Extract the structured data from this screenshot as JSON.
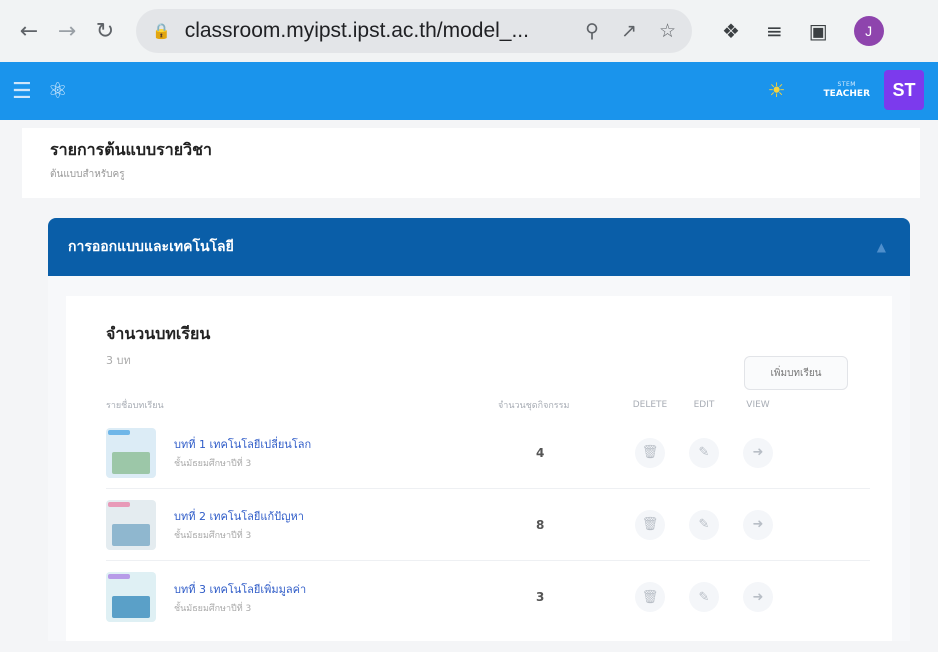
{
  "browser": {
    "url": "classroom.myipst.ipst.ac.th/model_...",
    "profile_initial": "J",
    "back_icon": "back-arrow-icon",
    "forward_icon": "forward-arrow-icon",
    "reload_icon": "reload-icon"
  },
  "appbar": {
    "role_small": "STEM",
    "role": "TEACHER",
    "user_initials": "ST",
    "colors": {
      "bar": "#1a94ec",
      "badge": "#7c3aed"
    }
  },
  "page": {
    "title": "รายการต้นแบบรายวิชา",
    "subtitle": "ต้นแบบสำหรับครู"
  },
  "section": {
    "title": "การออกแบบและเทคโนโลยี",
    "color": "#0a5ea8",
    "lessons_title": "จำนวนบทเรียน",
    "lessons_count": "3 บท",
    "add_button": "เพิ่มบทเรียน",
    "columns": {
      "name": "รายชื่อบทเรียน",
      "activity_count": "จำนวนชุดกิจกรรม",
      "delete": "DELETE",
      "edit": "EDIT",
      "view": "VIEW"
    },
    "lessons": [
      {
        "name": "บทที่ 1 เทคโนโลยีเปลี่ยนโลก",
        "grade": "ชั้นมัธยมศึกษาปีที่ 3",
        "activities": "4"
      },
      {
        "name": "บทที่ 2 เทคโนโลยีแก้ปัญหา",
        "grade": "ชั้นมัธยมศึกษาปีที่ 3",
        "activities": "8"
      },
      {
        "name": "บทที่ 3 เทคโนโลยีเพิ่มมูลค่า",
        "grade": "ชั้นมัธยมศึกษาปีที่ 3",
        "activities": "3"
      }
    ]
  }
}
